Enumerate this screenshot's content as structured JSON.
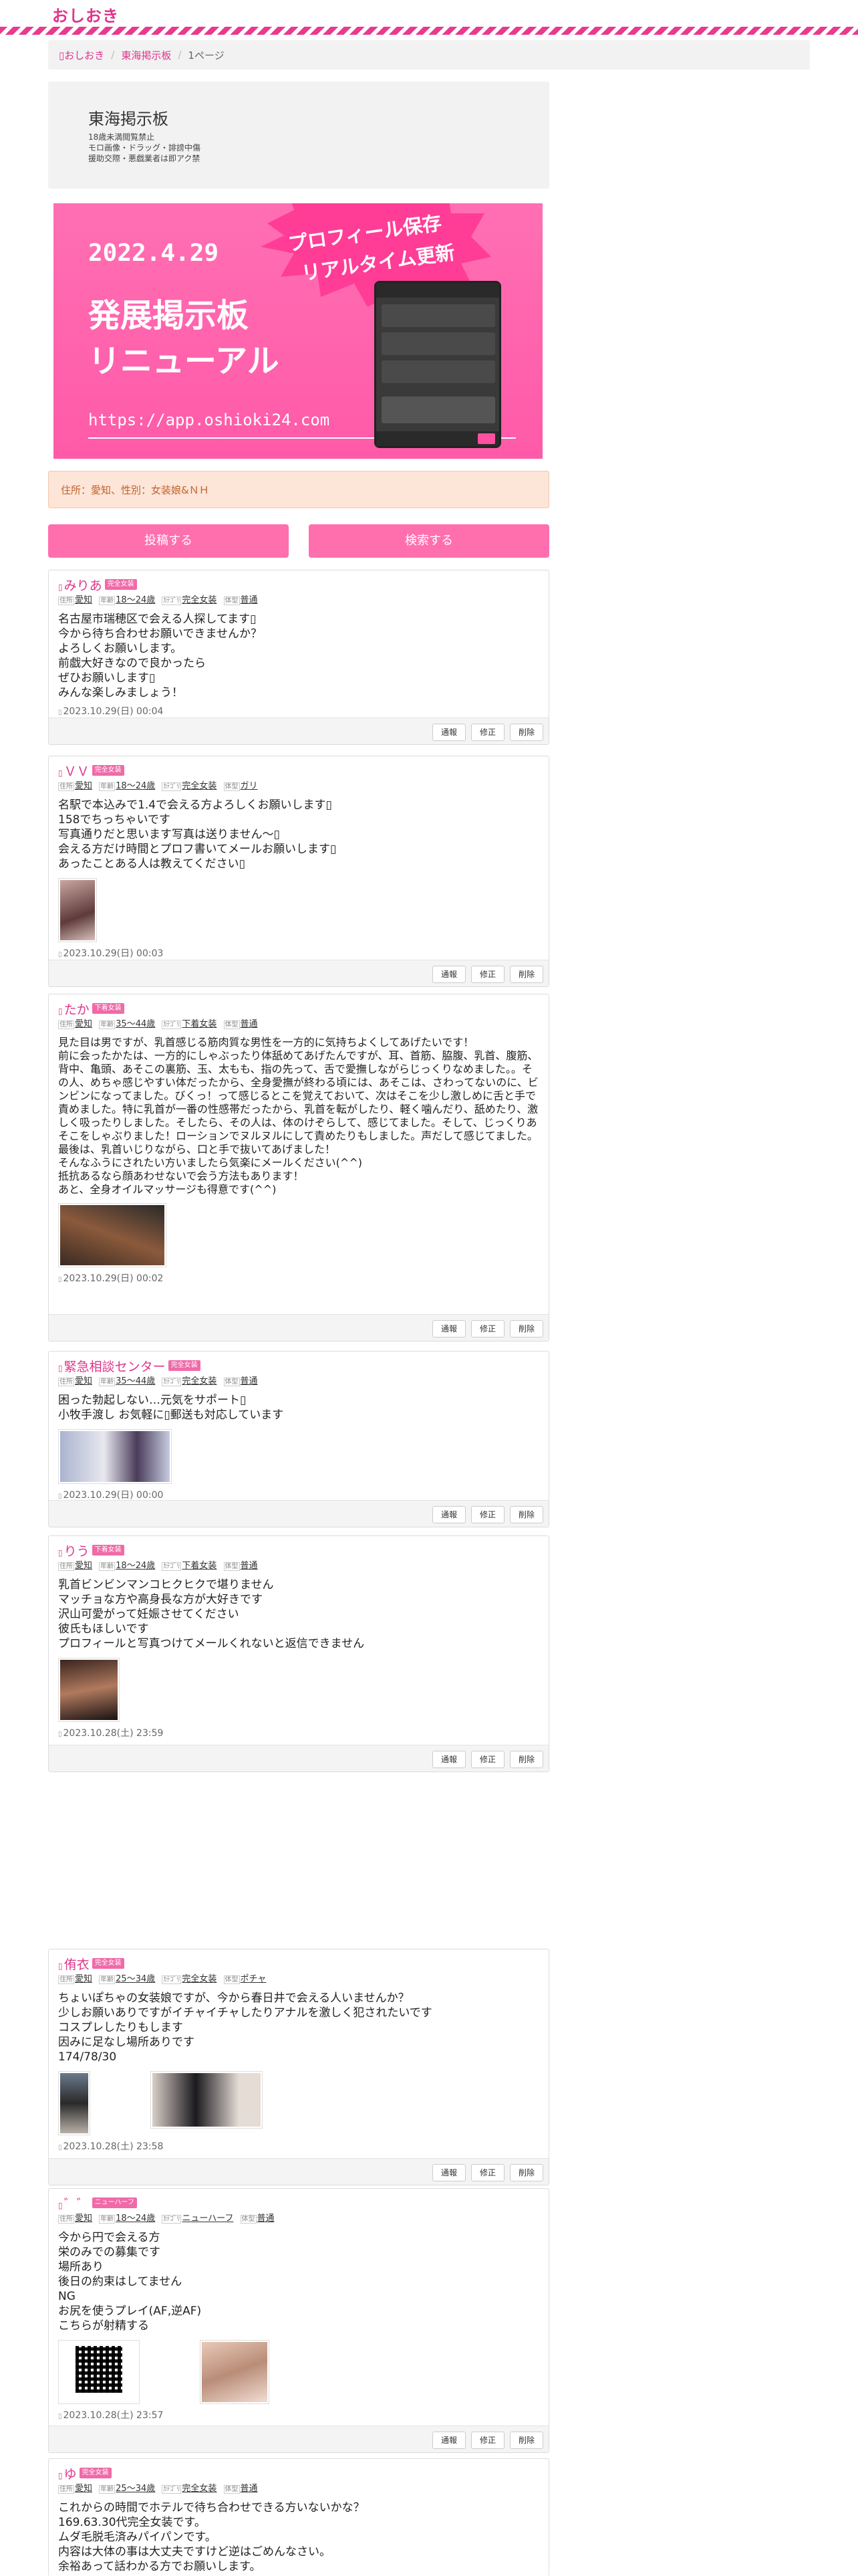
{
  "site": {
    "logo": "おしおき"
  },
  "breadcrumb": {
    "home": "おしおき",
    "board": "東海掲示板",
    "page": "1ページ"
  },
  "board": {
    "title": "東海掲示板",
    "notes": [
      "18歳未満閲覧禁止",
      "モロ画像・ドラッグ・誹謗中傷",
      "援助交際・悪戯業者は即アク禁"
    ]
  },
  "banner": {
    "date": "2022.4.29",
    "burst_line1": "プロフィール保存",
    "burst_line2": "リアルタイム更新",
    "line1": "発展掲示板",
    "line2": "リニューアル",
    "url": "https://app.oshioki24.com"
  },
  "filter": {
    "text": "住所：愛知、性別：女装娘&ＮＨ"
  },
  "actions": {
    "post": "投稿する",
    "search": "検索する"
  },
  "tag_keys": {
    "addr": "住所",
    "age": "年齢",
    "type": "ｶﾃｺﾞﾘ",
    "body": "体型"
  },
  "foot_buttons": {
    "report": "通報",
    "edit": "修正",
    "delete": "削除"
  },
  "posts": [
    {
      "name": "みりあ",
      "badge": "完全女装",
      "addr": "愛知",
      "age": "18〜24歳",
      "type": "完全女装",
      "body": "普通",
      "message": "名古屋市瑞穂区で会える人探してます▯\n今から待ち合わせお願いできませんか？\nよろしくお願いします。\n前戯大好きなので良かったら\nぜひお願いします▯\nみんな楽しみましょう！",
      "time": "2023.10.29(日) 00:04"
    },
    {
      "name": "ＶＶ",
      "badge": "完全女装",
      "addr": "愛知",
      "age": "18〜24歳",
      "type": "完全女装",
      "body": "ガリ",
      "message": "名駅で本込みで1.4で会える方よろしくお願いします▯\n158でちっちゃいです\n写真通りだと思います写真は送りません〜▯\n会える方だけ時間とプロフ書いてメールお願いします▯\nあったことある人は教えてください▯",
      "time": "2023.10.29(日) 00:03"
    },
    {
      "name": "たか",
      "badge": "下着女装",
      "addr": "愛知",
      "age": "35〜44歳",
      "type": "下着女装",
      "body": "普通",
      "message": "見た目は男ですが、乳首感じる筋肉質な男性を一方的に気持ちよくしてあげたいです！\n前に会ったかたは、一方的にしゃぶったり体舐めてあげたんですが、耳、首筋、脇腹、乳首、腹筋、背中、亀頭、あそこの裏筋、玉、太もも、指の先って、舌で愛撫しながらじっくりなめました。。その人、めちゃ感じやすい体だったから、全身愛撫が終わる頃には、あそこは、さわってないのに、ビンビンになってました。びくっ！って感じるとこを覚えておいて、次はそこを少し激しめに舌と手で責めました。特に乳首が一番の性感帯だったから、乳首を転がしたり、軽く噛んだり、舐めたり、激しく吸ったりしました。そしたら、その人は、体のけぞらして、感じてました。そして、じっくりあそこをしゃぶりました！ローションでヌルヌルにして責めたりもしました。声だして感じてました。最後は、乳首いじりながら、口と手で抜いてあげました！\nそんなふうにされたい方いましたら気楽にメールください(^^)\n抵抗あるなら顔あわせないで会う方法もあります！\nあと、全身オイルマッサージも得意です(^^)",
      "time": "2023.10.29(日) 00:02"
    },
    {
      "name": "緊急相談センター",
      "badge": "完全女装",
      "addr": "愛知",
      "age": "35〜44歳",
      "type": "完全女装",
      "body": "普通",
      "message": "困った勃起しない…元気をサポート▯\n小牧手渡し お気軽に▯郵送も対応しています",
      "time": "2023.10.29(日) 00:00"
    },
    {
      "name": "りう",
      "badge": "下着女装",
      "addr": "愛知",
      "age": "18〜24歳",
      "type": "下着女装",
      "body": "普通",
      "message": "乳首ビンビンマンコヒクヒクで堪りません\nマッチョな方や高身長な方が大好きです\n沢山可愛がって妊娠させてください\n彼氏もほしいです\nプロフィールと写真つけてメールくれないと返信できません",
      "time": "2023.10.28(土) 23:59"
    },
    {
      "name": "侑衣",
      "badge": "完全女装",
      "addr": "愛知",
      "age": "25〜34歳",
      "type": "完全女装",
      "body": "ポチャ",
      "message": "ちょいぽちゃの女装娘ですが、今から春日井で会える人いませんか？\n少しお願いありですがイチャイチャしたりアナルを激しく犯されたいです\nコスプレしたりもします\n因みに足なし場所ありです\n174/78/30",
      "time": "2023.10.28(土) 23:58"
    },
    {
      "name": "゛゛",
      "badge": "ニューハーフ",
      "addr": "愛知",
      "age": "18〜24歳",
      "type": "ニューハーフ",
      "body": "普通",
      "message": "今から円で会える方\n栄のみでの募集です\n場所あり\n後日の約束はしてません\nNG\nお尻を使うプレイ(AF,逆AF)\nこちらが射精する",
      "time": "2023.10.28(土) 23:57"
    },
    {
      "name": "ゆ",
      "badge": "完全女装",
      "addr": "愛知",
      "age": "25〜34歳",
      "type": "完全女装",
      "body": "普通",
      "message": "これからの時間でホテルで待ち合わせできる方いないかな？\n169.63.30代完全女装です。\nムダ毛脱毛済みパイパンです。\n内容は大体の事は大丈夫ですけど逆はごめんなさい。\n余裕あって話わかる方でお願いします。",
      "time": ""
    }
  ]
}
